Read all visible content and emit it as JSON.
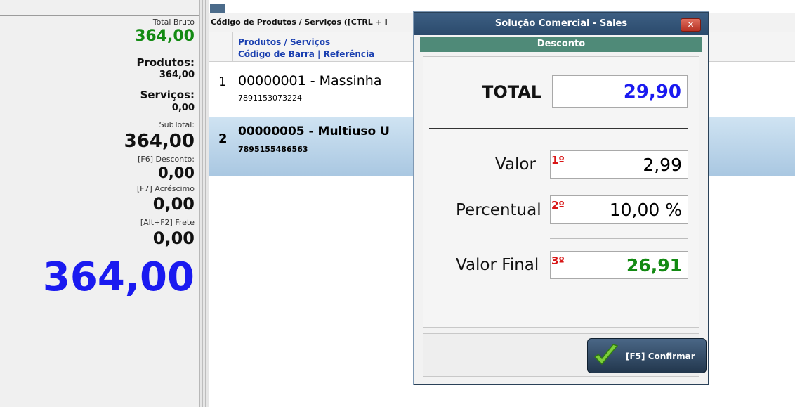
{
  "left_panel": {
    "total_bruto_label": "Total Bruto",
    "total_bruto_value": "364,00",
    "produtos_label": "Produtos:",
    "produtos_value": "364,00",
    "servicos_label": "Serviços:",
    "servicos_value": "0,00",
    "subtotal_label": "SubTotal:",
    "subtotal_value": "364,00",
    "desconto_label": "[F6] Desconto:",
    "desconto_value": "0,00",
    "acrescimo_label": "[F7] Acréscimo",
    "acrescimo_value": "0,00",
    "frete_label": "[Alt+F2] Frete",
    "frete_value": "0,00",
    "grand_total": "364,00"
  },
  "grid": {
    "title": "Código de Produtos / Serviços ([CTRL + I",
    "header_line1": "Produtos / Serviços",
    "header_line2": "Código de Barra | Referência",
    "rows": [
      {
        "index": "1",
        "code": "00000001  -  Massinha",
        "barcode": "7891153073224"
      },
      {
        "index": "2",
        "code": "00000005  -  Multiuso U",
        "barcode": "7895155486563"
      }
    ]
  },
  "dialog": {
    "title": "Solução Comercial - Sales",
    "close_label": "✕",
    "subtitle": "Desconto",
    "total_label": "TOTAL",
    "total_value": "29,90",
    "valor_label": "Valor",
    "valor_order": "1º",
    "valor_value": "2,99",
    "percentual_label": "Percentual",
    "percentual_order": "2º",
    "percentual_value": "10,00 %",
    "valor_final_label": "Valor Final",
    "valor_final_order": "3º",
    "valor_final_value": "26,91",
    "confirm_label": "[F5] Confirmar"
  },
  "colors": {
    "blue_value": "#1a1af0",
    "green_value": "#138a13",
    "order_red": "#d81616",
    "title_bar": "#2b4a6c",
    "subtitle_bar": "#4f8a78"
  }
}
